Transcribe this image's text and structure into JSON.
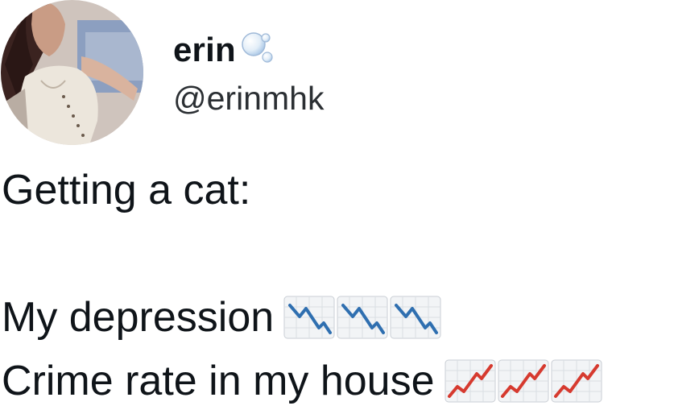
{
  "user": {
    "display_name": "erin",
    "handle": "@erinmhk",
    "name_icon": "bubbles-icon"
  },
  "tweet": {
    "lines": [
      "Getting a cat:",
      "My depression",
      "Crime rate in my house"
    ],
    "line_emojis": {
      "depression": [
        "chart-decreasing-icon",
        "chart-decreasing-icon",
        "chart-decreasing-icon"
      ],
      "crime_rate": [
        "chart-increasing-icon",
        "chart-increasing-icon",
        "chart-increasing-icon"
      ]
    }
  },
  "colors": {
    "decreasing_trend": "#2f6fb0",
    "increasing_trend": "#d63a2f",
    "handle_text": "#2b2f33"
  }
}
